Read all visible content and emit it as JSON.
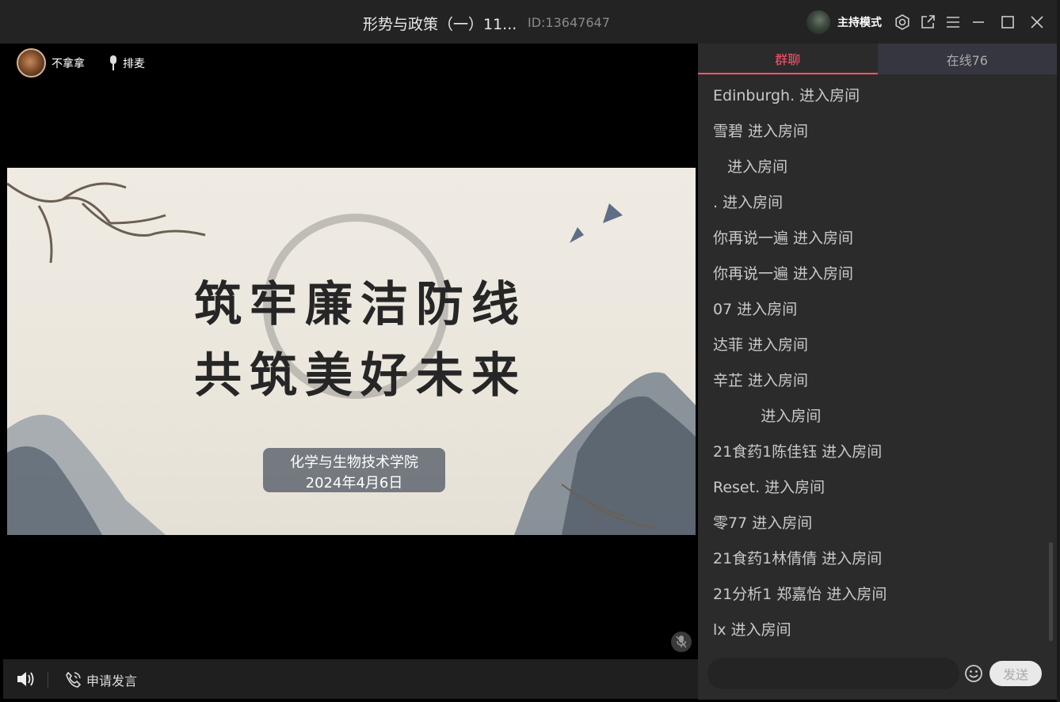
{
  "window": {
    "title": "形势与政策（一）11...",
    "room_id": "ID:13647647",
    "host_mode_label": "主持模式"
  },
  "stage": {
    "speaker_name": "不拿拿",
    "queue_label": "排麦"
  },
  "slide": {
    "line1": "筑牢廉洁防线",
    "line2": "共筑美好未来",
    "org": "化学与生物技术学院",
    "date": "2024年4月6日"
  },
  "bottombar": {
    "apply_label": "申请发言"
  },
  "chat": {
    "tab_group": "群聊",
    "tab_online": "在线76",
    "messages": [
      "Edinburgh. 进入房间",
      "雪碧 进入房间",
      "   进入房间",
      ". 进入房间",
      "你再说一遍 进入房间",
      "你再说一遍 进入房间",
      "07 进入房间",
      "达菲 进入房间",
      "辛芷 进入房间",
      "          进入房间",
      "21食药1陈佳钰 进入房间",
      "Reset. 进入房间",
      "零77 进入房间",
      "21食药1林倩倩 进入房间",
      "21分析1 郑嘉怡 进入房间",
      "lx 进入房间"
    ],
    "input_placeholder": "",
    "send_label": "发送"
  },
  "colors": {
    "accent": "#ff5470",
    "titlebar": "#232323",
    "chat_bg": "#2b2b2b"
  }
}
